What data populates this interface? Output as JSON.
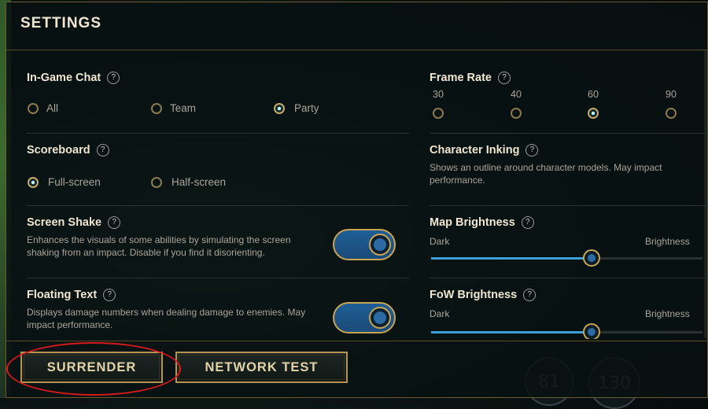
{
  "panel": {
    "title": "SETTINGS"
  },
  "in_game_chat": {
    "label": "In-Game Chat",
    "help": "?",
    "options": [
      "All",
      "Team",
      "Party"
    ],
    "selected": "Party"
  },
  "frame_rate": {
    "label": "Frame Rate",
    "help": "?",
    "options": [
      "30",
      "40",
      "60",
      "90"
    ],
    "selected": "60"
  },
  "scoreboard": {
    "label": "Scoreboard",
    "help": "?",
    "options": [
      "Full-screen",
      "Half-screen"
    ],
    "selected": "Full-screen"
  },
  "character_inking": {
    "label": "Character Inking",
    "help": "?",
    "desc_1": "Shows an outline around character models. May impact",
    "desc_2": "performance."
  },
  "screen_shake": {
    "label": "Screen Shake",
    "help": "?",
    "desc_1": "Enhances the visuals of some abilities by simulating the screen",
    "desc_2": "shaking from an impact. Disable if you find it disorienting.",
    "enabled": true
  },
  "map_brightness": {
    "label": "Map Brightness",
    "help": "?",
    "min_label": "Dark",
    "max_label": "Brightness",
    "value_pct": 59
  },
  "floating_text": {
    "label": "Floating Text",
    "help": "?",
    "desc_1": "Displays damage numbers when dealing damage to enemies. May",
    "desc_2": "impact performance.",
    "enabled": true
  },
  "fow_brightness": {
    "label": "FoW Brightness",
    "help": "?",
    "min_label": "Dark",
    "max_label": "Brightness",
    "value_pct": 59
  },
  "buttons": {
    "surrender": "SURRENDER",
    "network_test": "NETWORK TEST"
  },
  "hud": {
    "cooldown_1": "81",
    "cooldown_2": "130"
  },
  "colors": {
    "gold": "#c8a455",
    "accent_blue": "#3ca0d8",
    "highlight_red": "#d6191c"
  }
}
